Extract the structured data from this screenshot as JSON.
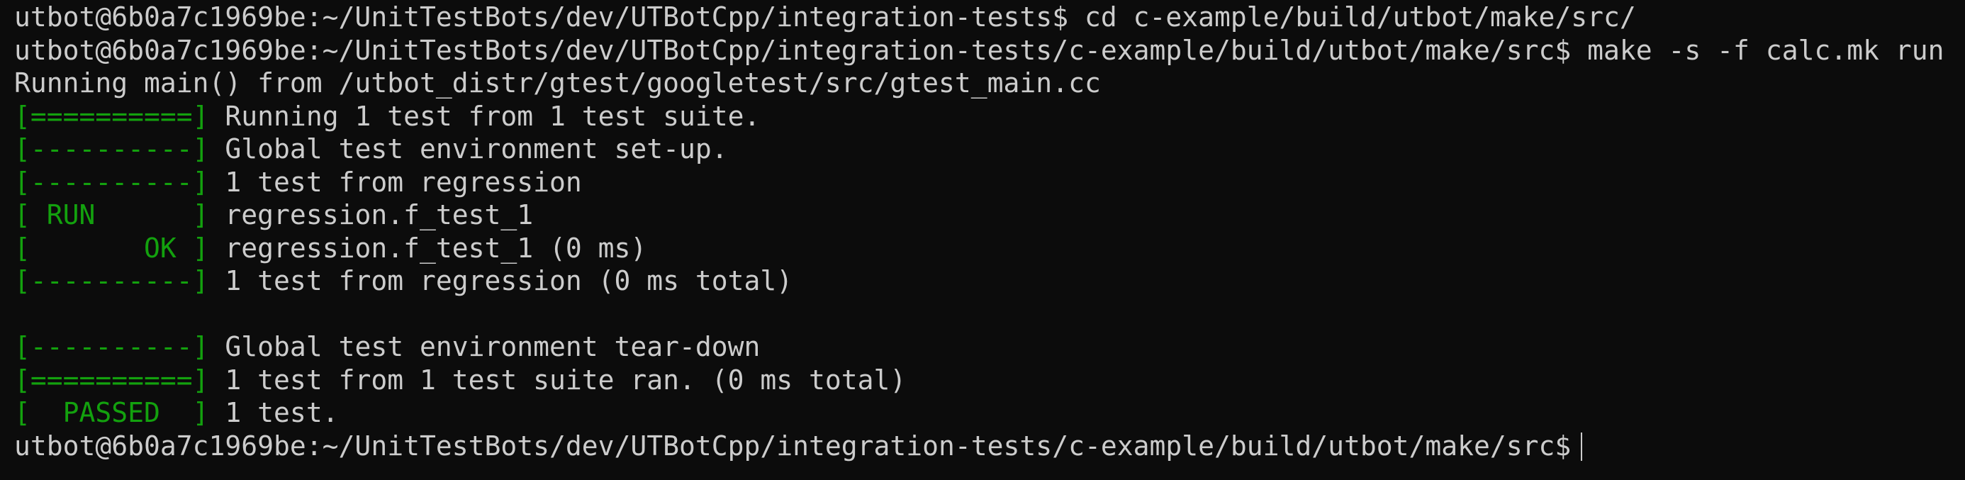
{
  "terminal": {
    "colors": {
      "background": "#0c0c0c",
      "foreground": "#cccccc",
      "tag": "#13a10e"
    },
    "lines": [
      {
        "tag": "",
        "text": "utbot@6b0a7c1969be:~/UnitTestBots/dev/UTBotCpp/integration-tests$ cd c-example/build/utbot/make/src/"
      },
      {
        "tag": "",
        "text": "utbot@6b0a7c1969be:~/UnitTestBots/dev/UTBotCpp/integration-tests/c-example/build/utbot/make/src$ make -s -f calc.mk run"
      },
      {
        "tag": "",
        "text": "Running main() from /utbot_distr/gtest/googletest/src/gtest_main.cc"
      },
      {
        "tag": "[==========]",
        "text": " Running 1 test from 1 test suite."
      },
      {
        "tag": "[----------]",
        "text": " Global test environment set-up."
      },
      {
        "tag": "[----------]",
        "text": " 1 test from regression"
      },
      {
        "tag": "[ RUN      ]",
        "text": " regression.f_test_1"
      },
      {
        "tag": "[       OK ]",
        "text": " regression.f_test_1 (0 ms)"
      },
      {
        "tag": "[----------]",
        "text": " 1 test from regression (0 ms total)"
      },
      {
        "tag": "",
        "text": ""
      },
      {
        "tag": "[----------]",
        "text": " Global test environment tear-down"
      },
      {
        "tag": "[==========]",
        "text": " 1 test from 1 test suite ran. (0 ms total)"
      },
      {
        "tag": "[  PASSED  ]",
        "text": " 1 test."
      }
    ],
    "prompt": "utbot@6b0a7c1969be:~/UnitTestBots/dev/UTBotCpp/integration-tests/c-example/build/utbot/make/src$"
  }
}
